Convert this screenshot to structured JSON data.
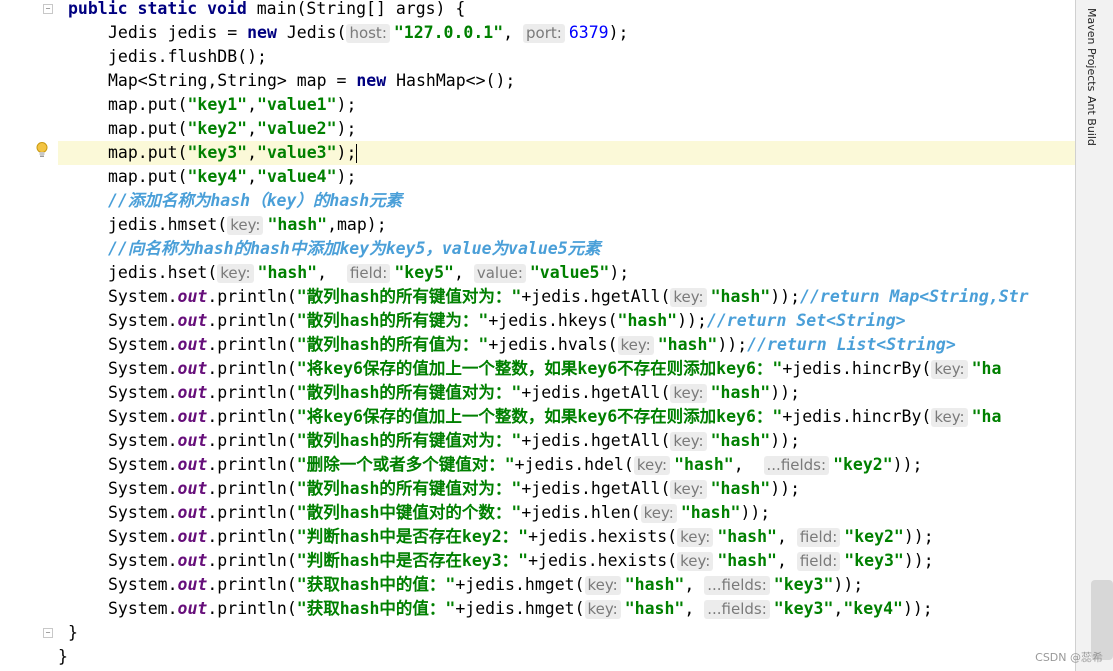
{
  "sidebar_tabs": {
    "maven": "Maven Projects",
    "ant": "Ant Build"
  },
  "watermark": "CSDN @蕊希",
  "code": {
    "l0": [
      "public static void",
      " main(String[] args) {"
    ],
    "l1": [
      "Jedis jedis = ",
      "new",
      " Jedis(",
      "host:",
      "\"127.0.0.1\"",
      ", ",
      "port:",
      "6379",
      ");"
    ],
    "l2": [
      "jedis.flushDB();"
    ],
    "l3": [
      "Map<String,String> map = ",
      "new",
      " HashMap<>();"
    ],
    "l4": [
      "map.put(",
      "\"key1\"",
      ",",
      "\"value1\"",
      ");"
    ],
    "l5": [
      "map.put(",
      "\"key2\"",
      ",",
      "\"value2\"",
      ");"
    ],
    "l6": [
      "map.put(",
      "\"key3\"",
      ",",
      "\"value3\"",
      ");"
    ],
    "l7": [
      "map.put(",
      "\"key4\"",
      ",",
      "\"value4\"",
      ");"
    ],
    "l8": [
      "//添加名称为hash（key）的hash元素"
    ],
    "l9": [
      "jedis.hmset(",
      "key:",
      "\"hash\"",
      ",map);"
    ],
    "l10": [
      "//向名称为hash的hash中添加key为key5，value为value5元素"
    ],
    "l11": [
      "jedis.hset(",
      "key:",
      "\"hash\"",
      ",  ",
      "field:",
      "\"key5\"",
      ", ",
      "value:",
      "\"value5\"",
      ");"
    ],
    "l12": [
      "System.",
      "out",
      ".println(",
      "\"散列hash的所有键值对为：\"",
      "+jedis.hgetAll(",
      "key:",
      "\"hash\"",
      "));",
      "//return Map<String,Str"
    ],
    "l13": [
      "System.",
      "out",
      ".println(",
      "\"散列hash的所有键为：\"",
      "+jedis.hkeys(",
      "\"hash\"",
      "));",
      "//return Set<String>"
    ],
    "l14": [
      "System.",
      "out",
      ".println(",
      "\"散列hash的所有值为：\"",
      "+jedis.hvals(",
      "key:",
      "\"hash\"",
      "));",
      "//return List<String>"
    ],
    "l15": [
      "System.",
      "out",
      ".println(",
      "\"将key6保存的值加上一个整数，如果key6不存在则添加key6：\"",
      "+jedis.hincrBy(",
      "key:",
      "\"ha"
    ],
    "l16": [
      "System.",
      "out",
      ".println(",
      "\"散列hash的所有键值对为：\"",
      "+jedis.hgetAll(",
      "key:",
      "\"hash\"",
      "));"
    ],
    "l17": [
      "System.",
      "out",
      ".println(",
      "\"将key6保存的值加上一个整数，如果key6不存在则添加key6：\"",
      "+jedis.hincrBy(",
      "key:",
      "\"ha"
    ],
    "l18": [
      "System.",
      "out",
      ".println(",
      "\"散列hash的所有键值对为：\"",
      "+jedis.hgetAll(",
      "key:",
      "\"hash\"",
      "));"
    ],
    "l19": [
      "System.",
      "out",
      ".println(",
      "\"删除一个或者多个键值对：\"",
      "+jedis.hdel(",
      "key:",
      "\"hash\"",
      ",  ",
      "...fields:",
      "\"key2\"",
      "));"
    ],
    "l20": [
      "System.",
      "out",
      ".println(",
      "\"散列hash的所有键值对为：\"",
      "+jedis.hgetAll(",
      "key:",
      "\"hash\"",
      "));"
    ],
    "l21": [
      "System.",
      "out",
      ".println(",
      "\"散列hash中键值对的个数：\"",
      "+jedis.hlen(",
      "key:",
      "\"hash\"",
      "));"
    ],
    "l22": [
      "System.",
      "out",
      ".println(",
      "\"判断hash中是否存在key2：\"",
      "+jedis.hexists(",
      "key:",
      "\"hash\"",
      ", ",
      "field:",
      "\"key2\"",
      "));"
    ],
    "l23": [
      "System.",
      "out",
      ".println(",
      "\"判断hash中是否存在key3：\"",
      "+jedis.hexists(",
      "key:",
      "\"hash\"",
      ", ",
      "field:",
      "\"key3\"",
      "));"
    ],
    "l24": [
      "System.",
      "out",
      ".println(",
      "\"获取hash中的值：\"",
      "+jedis.hmget(",
      "key:",
      "\"hash\"",
      ", ",
      "...fields:",
      "\"key3\"",
      "));"
    ],
    "l25": [
      "System.",
      "out",
      ".println(",
      "\"获取hash中的值：\"",
      "+jedis.hmget(",
      "key:",
      "\"hash\"",
      ", ",
      "...fields:",
      "\"key3\"",
      ",",
      "\"key4\"",
      "));"
    ],
    "l26": [
      "}"
    ],
    "l27": [
      "}"
    ]
  }
}
